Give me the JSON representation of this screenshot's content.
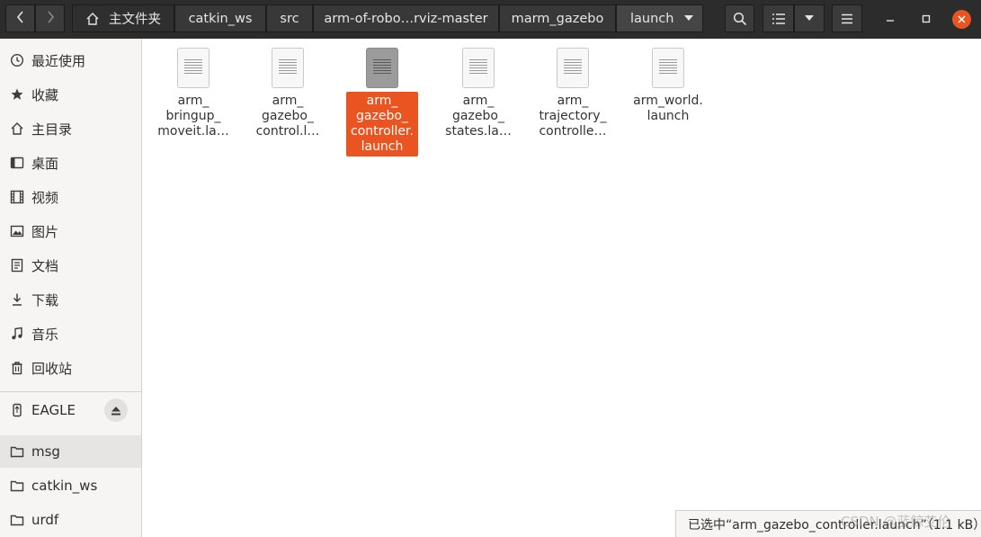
{
  "breadcrumbs": [
    "主文件夹",
    "catkin_ws",
    "src",
    "arm-of-robo…rviz-master",
    "marm_gazebo",
    "launch"
  ],
  "sidebar": {
    "places": [
      {
        "label": "最近使用",
        "icon": "clock-icon"
      },
      {
        "label": "收藏",
        "icon": "star-icon"
      },
      {
        "label": "主目录",
        "icon": "home-icon"
      },
      {
        "label": "桌面",
        "icon": "desktop-icon"
      },
      {
        "label": "视频",
        "icon": "video-icon"
      },
      {
        "label": "图片",
        "icon": "picture-icon"
      },
      {
        "label": "文档",
        "icon": "document-icon"
      },
      {
        "label": "下载",
        "icon": "download-icon"
      },
      {
        "label": "音乐",
        "icon": "music-icon"
      },
      {
        "label": "回收站",
        "icon": "trash-icon"
      }
    ],
    "devices": [
      {
        "label": "EAGLE",
        "icon": "usb-drive-icon"
      }
    ],
    "bookmarks": [
      {
        "label": "msg",
        "icon": "folder-icon"
      },
      {
        "label": "catkin_ws",
        "icon": "folder-icon"
      },
      {
        "label": "urdf",
        "icon": "folder-icon"
      }
    ]
  },
  "files": [
    {
      "name": "arm_\nbringup_\nmoveit.la…",
      "selected": false
    },
    {
      "name": "arm_\ngazebo_\ncontrol.l…",
      "selected": false
    },
    {
      "name": "arm_\ngazebo_\ncontroller.\nlaunch",
      "selected": true
    },
    {
      "name": "arm_\ngazebo_\nstates.la…",
      "selected": false
    },
    {
      "name": "arm_\ntrajectory_\ncontrolle…",
      "selected": false
    },
    {
      "name": "arm_world.\nlaunch",
      "selected": false
    }
  ],
  "status": "已选中“arm_gazebo_controller.launch”（1.1 kB）",
  "watermark": "CSDN @蓝鲸艾伦",
  "colors": {
    "accent": "#e95420",
    "header": "#2c2c2c",
    "sidebar": "#f6f5f4"
  }
}
